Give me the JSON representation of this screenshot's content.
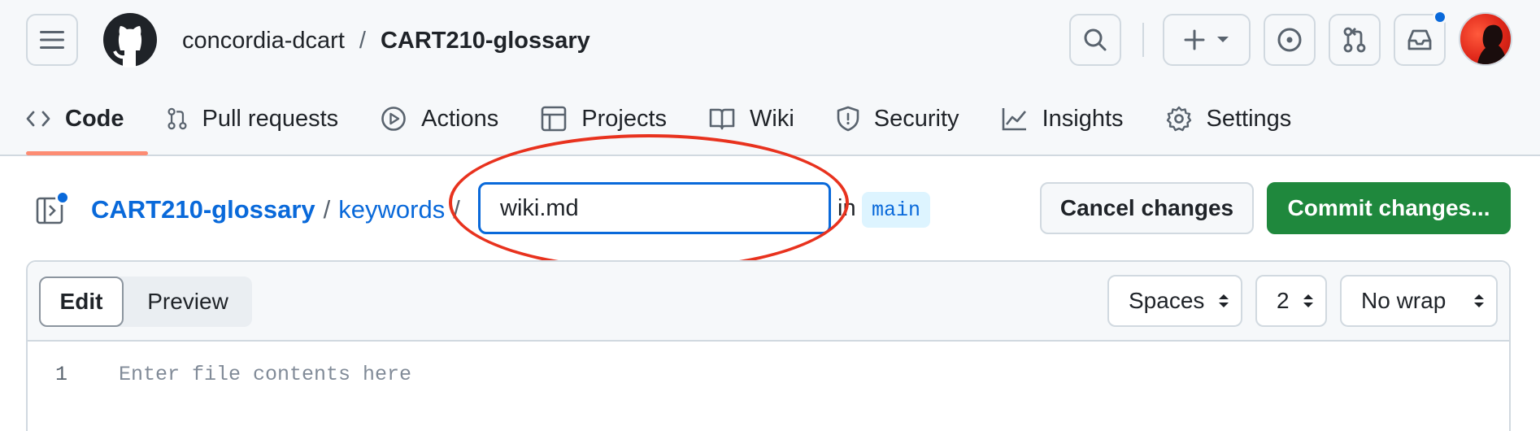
{
  "header": {
    "owner": "concordia-dcart",
    "separator": "/",
    "repo": "CART210-glossary",
    "icons": [
      "menu-icon",
      "github-logo",
      "search-icon",
      "plus-icon",
      "chevron-down-icon",
      "issue-icon",
      "pull-request-icon",
      "inbox-icon"
    ]
  },
  "tabs": [
    {
      "label": "Code",
      "icon": "code-icon",
      "active": true
    },
    {
      "label": "Pull requests",
      "icon": "pull-request-icon"
    },
    {
      "label": "Actions",
      "icon": "play-icon"
    },
    {
      "label": "Projects",
      "icon": "table-icon"
    },
    {
      "label": "Wiki",
      "icon": "book-icon"
    },
    {
      "label": "Security",
      "icon": "shield-icon"
    },
    {
      "label": "Insights",
      "icon": "graph-icon"
    },
    {
      "label": "Settings",
      "icon": "gear-icon"
    }
  ],
  "pathbar": {
    "repo": "CART210-glossary",
    "sep": "/",
    "dir": "keywords",
    "filename": "wiki.md",
    "in_label": "in",
    "branch": "main",
    "cancel_label": "Cancel changes",
    "commit_label": "Commit changes..."
  },
  "editor": {
    "edit_label": "Edit",
    "preview_label": "Preview",
    "indent_mode": "Spaces",
    "indent_size": "2",
    "wrap_mode": "No wrap",
    "line_number": "1",
    "placeholder": "Enter file contents here"
  },
  "colors": {
    "accent": "#0969da",
    "commit_green": "#1f883d",
    "annotation_red": "#e8321e",
    "tab_underline": "#fd8c73"
  }
}
